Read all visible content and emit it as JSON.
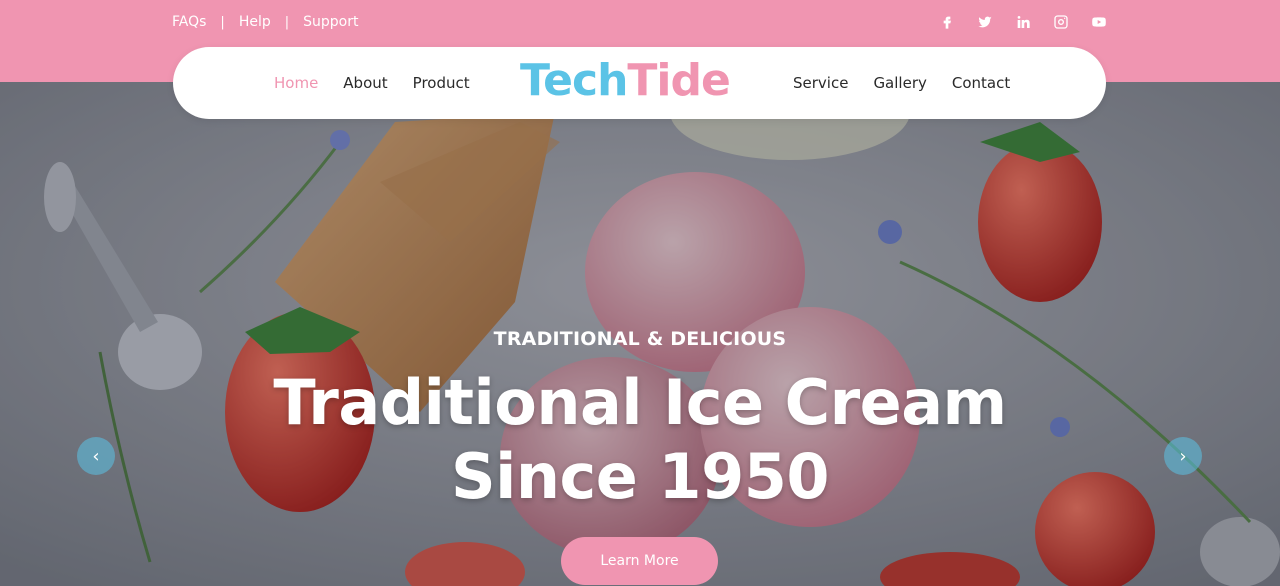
{
  "topbar": {
    "links": [
      {
        "label": "FAQs"
      },
      {
        "label": "Help"
      },
      {
        "label": "Support"
      }
    ],
    "separator": "|",
    "socials": [
      {
        "icon": "facebook-icon"
      },
      {
        "icon": "twitter-icon"
      },
      {
        "icon": "linkedin-icon"
      },
      {
        "icon": "instagram-icon"
      },
      {
        "icon": "youtube-icon"
      }
    ]
  },
  "nav": {
    "left": [
      {
        "label": "Home",
        "active": true
      },
      {
        "label": "About"
      },
      {
        "label": "Product"
      }
    ],
    "logo": {
      "part1": "Tech",
      "part2": "Tide"
    },
    "right": [
      {
        "label": "Service"
      },
      {
        "label": "Gallery"
      },
      {
        "label": "Contact"
      }
    ]
  },
  "hero": {
    "kicker": "TRADITIONAL & DELICIOUS",
    "headline_line1": "Traditional Ice Cream",
    "headline_line2": "Since 1950",
    "cta": "Learn More",
    "prev": "‹",
    "next": "›"
  },
  "colors": {
    "pink": "#f095b1",
    "blue": "#5bc3e6"
  }
}
